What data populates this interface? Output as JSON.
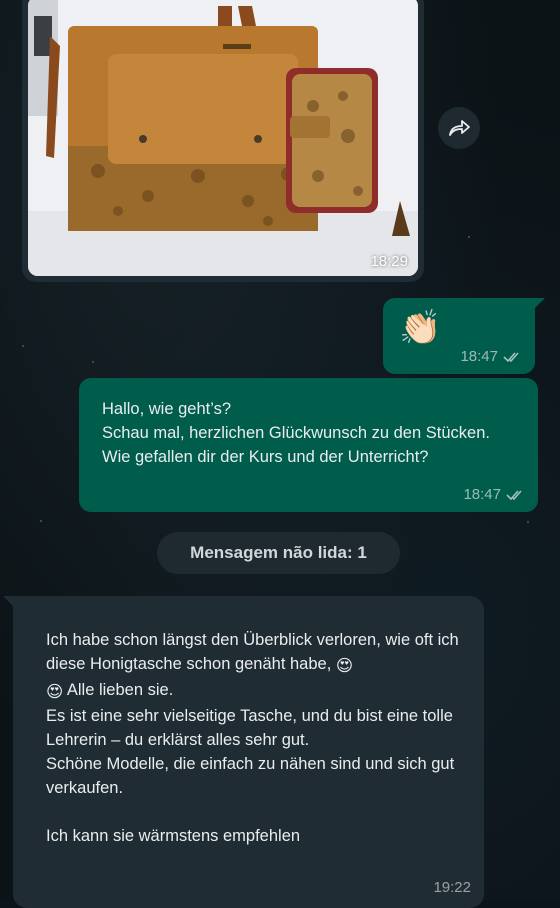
{
  "messages": {
    "image_message": {
      "time": "18:29"
    },
    "clap_message": {
      "emoji": "👏🏻",
      "time": "18:47"
    },
    "greeting_message": {
      "text": "Hallo, wie geht’s?\nSchau mal, herzlichen Glückwunsch zu den Stücken. Wie gefallen dir der Kurs und der Unterricht?",
      "time": "18:47"
    },
    "unread_label": "Mensagem não lida: 1",
    "reply_message": {
      "line1": "Ich habe schon längst den Überblick verloren, wie oft ich diese Honigtasche schon genäht habe, ",
      "emoji1": "😍",
      "emoji2": "😍",
      "line2": " Alle lieben sie.\nEs ist eine sehr vielseitige Tasche, und du bist eine tolle Lehrerin – du erklärst alles sehr gut.\nSchöne Modelle, die einfach zu nähen sind und sich gut verkaufen.\n\nIch kann sie wärmstens empfehlen",
      "time": "19:22"
    }
  },
  "colors": {
    "outgoing_bubble": "#005c4b",
    "incoming_bubble": "#202c33",
    "background": "#0b141a"
  },
  "icons": {
    "forward": "forward-icon",
    "read_receipt": "double-check-icon"
  }
}
